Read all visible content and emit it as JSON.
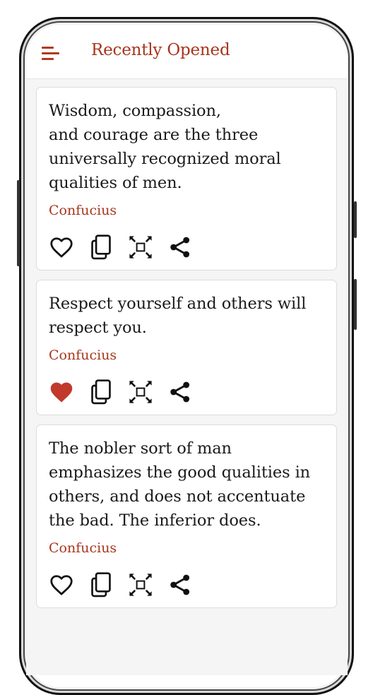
{
  "app": {
    "title": "Recently Opened",
    "accent_color": "#a8351c",
    "menu_icon": "hamburger-menu-icon"
  },
  "quotes": [
    {
      "text": "Wisdom, compassion,\nand courage are the three universally recognized moral qualities of men.",
      "author": "Confucius",
      "favorited": false
    },
    {
      "text": "Respect yourself and others will respect you.",
      "author": "Confucius",
      "favorited": true
    },
    {
      "text": "The nobler sort of man emphasizes the good qualities in others, and does not accentuate the bad. The inferior does.",
      "author": "Confucius",
      "favorited": false
    }
  ],
  "actions": [
    {
      "name": "favorite",
      "icon": "heart-icon"
    },
    {
      "name": "copy",
      "icon": "copy-icon"
    },
    {
      "name": "fullscreen",
      "icon": "expand-icon"
    },
    {
      "name": "share",
      "icon": "share-icon"
    }
  ],
  "colors": {
    "favorite_active": "#c0392b",
    "icon_default": "#111111"
  }
}
